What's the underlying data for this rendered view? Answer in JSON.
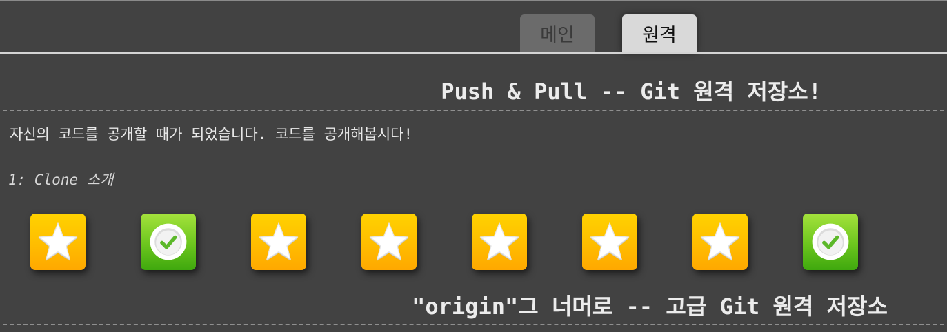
{
  "tabs": [
    {
      "label": "메인",
      "active": false
    },
    {
      "label": "원격",
      "active": true
    }
  ],
  "sections": [
    {
      "title": "Push & Pull -- Git 원격 저장소!",
      "description": "자신의 코드를 공개할 때가 되었습니다. 코드를 공개해봅시다!",
      "current_level_label": "1: Clone 소개",
      "levels": [
        {
          "status": "todo",
          "icon": "star-icon"
        },
        {
          "status": "done",
          "icon": "check-icon"
        },
        {
          "status": "todo",
          "icon": "star-icon"
        },
        {
          "status": "todo",
          "icon": "star-icon"
        },
        {
          "status": "todo",
          "icon": "star-icon"
        },
        {
          "status": "todo",
          "icon": "star-icon"
        },
        {
          "status": "todo",
          "icon": "star-icon"
        },
        {
          "status": "done",
          "icon": "check-icon"
        }
      ]
    },
    {
      "title": "\"origin\"그 너머로 -- 고급 Git 원격 저장소"
    }
  ],
  "colors": {
    "background": "#424242",
    "todo": "#ffbd00",
    "done": "#6cc61e",
    "active_tab": "#d9d9d9",
    "inactive_tab": "#6b6b6b"
  }
}
